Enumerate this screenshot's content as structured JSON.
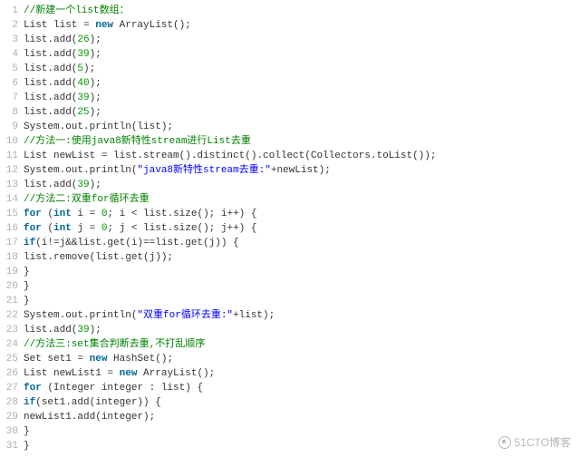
{
  "watermark": "51CTO博客",
  "lines": [
    {
      "n": 1,
      "tokens": [
        {
          "c": "comment",
          "t": "//新建一个list数组："
        }
      ]
    },
    {
      "n": 2,
      "tokens": [
        {
          "c": "plain",
          "t": "List list = "
        },
        {
          "c": "keyword",
          "t": "new"
        },
        {
          "c": "plain",
          "t": " ArrayList();"
        }
      ]
    },
    {
      "n": 3,
      "tokens": [
        {
          "c": "plain",
          "t": "list.add("
        },
        {
          "c": "number",
          "t": "26"
        },
        {
          "c": "plain",
          "t": ");"
        }
      ]
    },
    {
      "n": 4,
      "tokens": [
        {
          "c": "plain",
          "t": "list.add("
        },
        {
          "c": "number",
          "t": "39"
        },
        {
          "c": "plain",
          "t": ");"
        }
      ]
    },
    {
      "n": 5,
      "tokens": [
        {
          "c": "plain",
          "t": "list.add("
        },
        {
          "c": "number",
          "t": "5"
        },
        {
          "c": "plain",
          "t": ");"
        }
      ]
    },
    {
      "n": 6,
      "tokens": [
        {
          "c": "plain",
          "t": "list.add("
        },
        {
          "c": "number",
          "t": "40"
        },
        {
          "c": "plain",
          "t": ");"
        }
      ]
    },
    {
      "n": 7,
      "tokens": [
        {
          "c": "plain",
          "t": "list.add("
        },
        {
          "c": "number",
          "t": "39"
        },
        {
          "c": "plain",
          "t": ");"
        }
      ]
    },
    {
      "n": 8,
      "tokens": [
        {
          "c": "plain",
          "t": "list.add("
        },
        {
          "c": "number",
          "t": "25"
        },
        {
          "c": "plain",
          "t": ");"
        }
      ]
    },
    {
      "n": 9,
      "tokens": [
        {
          "c": "plain",
          "t": "System.out.println(list);"
        }
      ]
    },
    {
      "n": 10,
      "tokens": [
        {
          "c": "comment",
          "t": "//方法一:使用java8新特性stream进行List去重"
        }
      ]
    },
    {
      "n": 11,
      "tokens": [
        {
          "c": "plain",
          "t": "List newList = list.stream().distinct().collect(Collectors.toList());"
        }
      ]
    },
    {
      "n": 12,
      "tokens": [
        {
          "c": "plain",
          "t": "System.out.println("
        },
        {
          "c": "string",
          "t": "\"java8新特性stream去重:\""
        },
        {
          "c": "plain",
          "t": "+newList);"
        }
      ]
    },
    {
      "n": 13,
      "tokens": [
        {
          "c": "plain",
          "t": "list.add("
        },
        {
          "c": "number",
          "t": "39"
        },
        {
          "c": "plain",
          "t": ");"
        }
      ]
    },
    {
      "n": 14,
      "tokens": [
        {
          "c": "comment",
          "t": "//方法二:双重for循环去重"
        }
      ]
    },
    {
      "n": 15,
      "tokens": [
        {
          "c": "keyword",
          "t": "for"
        },
        {
          "c": "plain",
          "t": " ("
        },
        {
          "c": "keyword",
          "t": "int"
        },
        {
          "c": "plain",
          "t": " i = "
        },
        {
          "c": "number",
          "t": "0"
        },
        {
          "c": "plain",
          "t": "; i < list.size(); i++) {"
        }
      ]
    },
    {
      "n": 16,
      "tokens": [
        {
          "c": "keyword",
          "t": "for"
        },
        {
          "c": "plain",
          "t": " ("
        },
        {
          "c": "keyword",
          "t": "int"
        },
        {
          "c": "plain",
          "t": " j = "
        },
        {
          "c": "number",
          "t": "0"
        },
        {
          "c": "plain",
          "t": "; j < list.size(); j++) {"
        }
      ]
    },
    {
      "n": 17,
      "tokens": [
        {
          "c": "keyword",
          "t": "if"
        },
        {
          "c": "plain",
          "t": "(i!=j&&list.get(i)==list.get(j)) {"
        }
      ]
    },
    {
      "n": 18,
      "tokens": [
        {
          "c": "plain",
          "t": "list.remove(list.get(j));"
        }
      ]
    },
    {
      "n": 19,
      "tokens": [
        {
          "c": "plain",
          "t": "}"
        }
      ]
    },
    {
      "n": 20,
      "tokens": [
        {
          "c": "plain",
          "t": "}"
        }
      ]
    },
    {
      "n": 21,
      "tokens": [
        {
          "c": "plain",
          "t": "}"
        }
      ]
    },
    {
      "n": 22,
      "tokens": [
        {
          "c": "plain",
          "t": "System.out.println("
        },
        {
          "c": "string",
          "t": "\"双重for循环去重:\""
        },
        {
          "c": "plain",
          "t": "+list);"
        }
      ]
    },
    {
      "n": 23,
      "tokens": [
        {
          "c": "plain",
          "t": "list.add("
        },
        {
          "c": "number",
          "t": "39"
        },
        {
          "c": "plain",
          "t": ");"
        }
      ]
    },
    {
      "n": 24,
      "tokens": [
        {
          "c": "comment",
          "t": "//方法三:set集合判断去重,不打乱顺序"
        }
      ]
    },
    {
      "n": 25,
      "tokens": [
        {
          "c": "plain",
          "t": "Set set1 = "
        },
        {
          "c": "keyword",
          "t": "new"
        },
        {
          "c": "plain",
          "t": " HashSet();"
        }
      ]
    },
    {
      "n": 26,
      "tokens": [
        {
          "c": "plain",
          "t": "List newList1 = "
        },
        {
          "c": "keyword",
          "t": "new"
        },
        {
          "c": "plain",
          "t": " ArrayList();"
        }
      ]
    },
    {
      "n": 27,
      "tokens": [
        {
          "c": "keyword",
          "t": "for"
        },
        {
          "c": "plain",
          "t": " (Integer integer : list) {"
        }
      ]
    },
    {
      "n": 28,
      "tokens": [
        {
          "c": "keyword",
          "t": "if"
        },
        {
          "c": "plain",
          "t": "(set1.add(integer)) {"
        }
      ]
    },
    {
      "n": 29,
      "tokens": [
        {
          "c": "plain",
          "t": "newList1.add(integer);"
        }
      ]
    },
    {
      "n": 30,
      "tokens": [
        {
          "c": "plain",
          "t": "}"
        }
      ]
    },
    {
      "n": 31,
      "tokens": [
        {
          "c": "plain",
          "t": "}"
        }
      ]
    }
  ]
}
